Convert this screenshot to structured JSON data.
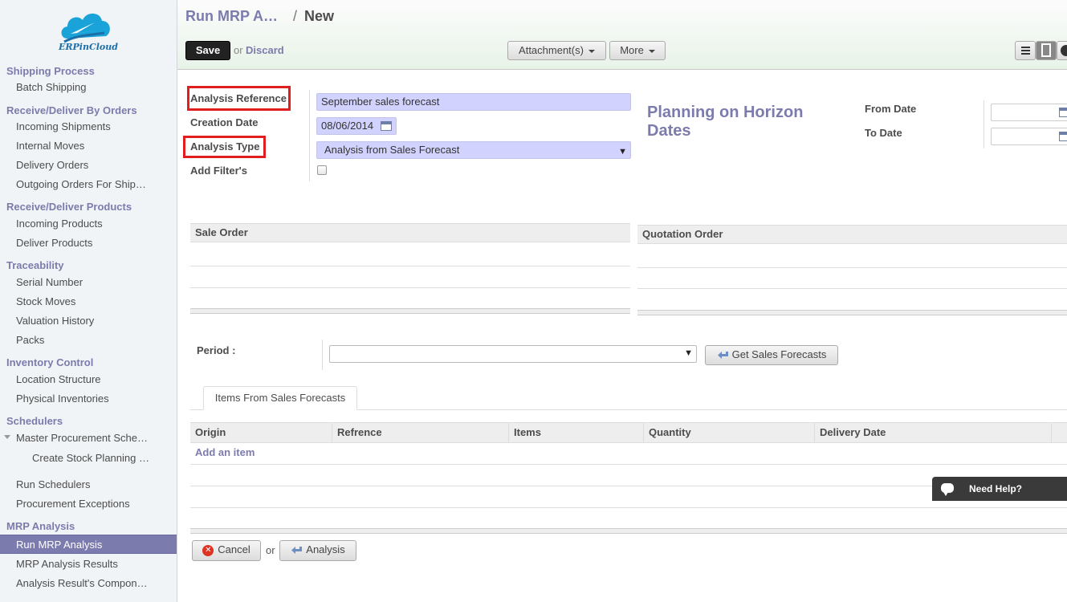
{
  "brand": {
    "logo_text": "ERPinCloud",
    "accent": "#7c7bad"
  },
  "sidebar": {
    "sections": [
      {
        "title": "Shipping Process",
        "items": [
          "Batch Shipping"
        ]
      },
      {
        "title": "Receive/Deliver By Orders",
        "items": [
          "Incoming Shipments",
          "Internal Moves",
          "Delivery Orders",
          "Outgoing Orders For Ship…"
        ]
      },
      {
        "title": "Receive/Deliver Products",
        "items": [
          "Incoming Products",
          "Deliver Products"
        ]
      },
      {
        "title": "Traceability",
        "items": [
          "Serial Number",
          "Stock Moves",
          "Valuation History",
          "Packs"
        ]
      },
      {
        "title": "Inventory Control",
        "items": [
          "Location Structure",
          "Physical Inventories"
        ]
      },
      {
        "title": "Schedulers",
        "items": [
          "Master Procurement Sche…",
          "Create Stock Planning …",
          "Run Schedulers",
          "Procurement Exceptions"
        ]
      },
      {
        "title": "MRP Analysis",
        "items": [
          "Run MRP Analysis",
          "MRP Analysis Results",
          "Analysis Result's Compon…"
        ]
      }
    ]
  },
  "header": {
    "breadcrumb_parent": "Run MRP A…",
    "breadcrumb_sep": "/",
    "breadcrumb_current": "New",
    "save_label": "Save",
    "or_label": "or",
    "discard_label": "Discard",
    "attachments_label": "Attachment(s)",
    "more_label": "More"
  },
  "form": {
    "analysis_reference_label": "Analysis Reference",
    "analysis_reference_value": "September sales forecast",
    "creation_date_label": "Creation Date",
    "creation_date_value": "08/06/2014",
    "analysis_type_label": "Analysis Type",
    "analysis_type_value": "Analysis from Sales Forecast",
    "add_filters_label": "Add Filter's",
    "horizon_title": "Planning on Horizon Dates",
    "from_date_label": "From Date",
    "to_date_label": "To Date",
    "sale_order_header": "Sale Order",
    "quotation_order_header": "Quotation Order",
    "period_label": "Period :",
    "period_value": "",
    "get_forecasts_label": "Get Sales Forecasts",
    "tab_label": "Items From Sales Forecasts",
    "grid_columns": [
      "Origin",
      "Refrence",
      "Items",
      "Quantity",
      "Delivery Date"
    ],
    "add_item_label": "Add an item",
    "cancel_label": "Cancel",
    "or_label": "or",
    "analysis_label": "Analysis"
  },
  "help": {
    "label": "Need Help?"
  }
}
